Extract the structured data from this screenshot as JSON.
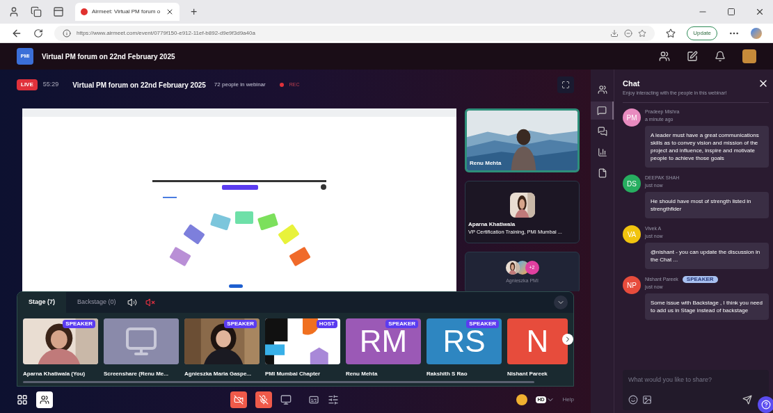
{
  "browser": {
    "tabs": [
      {
        "title": "Airmeet: Virtual PM forum o",
        "selected": true
      }
    ],
    "new_tab": "+",
    "url": "https://www.airmeet.com/event/0779f150-e912-11ef-b892-d9e9f3d9a40a",
    "update_button": "Update"
  },
  "header": {
    "logo": "PMI",
    "title": "Virtual PM forum on 22nd February 2025"
  },
  "session": {
    "live": "LIVE",
    "timer": "55:29",
    "title": "Virtual PM forum on 22nd February 2025",
    "attendees": "72 people in webinar",
    "recording": "REC"
  },
  "spotlight": [
    {
      "kind": "video",
      "name": "Renu Mehta",
      "selected": true
    },
    {
      "kind": "avatar",
      "name": "Aparna Khatiwala",
      "subtitle": "VP Certification Training, PMI Mumbai ...",
      "selected": false
    },
    {
      "kind": "group",
      "name": "Agnieszka PMI",
      "extra": "+2",
      "selected": false
    }
  ],
  "stage_tabs": [
    {
      "label": "Stage (7)",
      "selected": true
    },
    {
      "label": "Backstage (0)",
      "selected": false
    }
  ],
  "participants": [
    {
      "name": "Aparna Khatiwala  (You)",
      "badge": "SPEAKER"
    },
    {
      "kind": "screen",
      "name": "Screenshare (Renu Me..."
    },
    {
      "name": "Agnieszka Maria Gaspe...",
      "badge": "SPEAKER"
    },
    {
      "kind": "logo",
      "name": "PMI Mumbai Chapter",
      "badge": "HOST"
    },
    {
      "kind": "initials",
      "initials": "RM",
      "color": "#9b59b6",
      "name": "Renu Mehta",
      "badge": "SPEAKER"
    },
    {
      "kind": "initials",
      "initials": "RS",
      "color": "#2e86c1",
      "name": "Rakshith S Rao",
      "badge": "SPEAKER"
    },
    {
      "kind": "initials",
      "initials": "N",
      "color": "#e74c3c",
      "name": "Nishant Pareek"
    }
  ],
  "toolbar": {
    "help": "Help",
    "quality": "HD"
  },
  "sidebar": [
    {
      "kind": "people",
      "selected": false
    },
    {
      "kind": "chat",
      "selected": true
    },
    {
      "kind": "questions",
      "selected": false
    },
    {
      "kind": "polls",
      "selected": false
    },
    {
      "kind": "files",
      "selected": false
    }
  ],
  "chat": {
    "title": "Chat",
    "subtitle": "Enjoy interacting with the people in this webinar!",
    "messages": [
      {
        "initials": "PM",
        "color": "#e88bbf",
        "name": "Pradeep Mishra",
        "time": "a minute ago",
        "text": "A leader must have a great communications skills as to convey vision and mission of the project and influence, inspire and motivate people to achieve those goals"
      },
      {
        "initials": "DS",
        "color": "#27ae60",
        "name": "DEEPAK SHAH",
        "time": "just now",
        "text": "He should have most of strength listed in strengthfider"
      },
      {
        "initials": "VA",
        "color": "#f1c40f",
        "name": "Vivek A",
        "time": "just now",
        "text": "@nishant - you can update the discussion in the Chat ..."
      },
      {
        "initials": "NP",
        "color": "#e74c3c",
        "name": "Nishant Pareek",
        "badge": "SPEAKER",
        "time": "just now",
        "text": "Some issue with Backstage , I think you need to add us in Stage instead of backstage"
      }
    ],
    "input": {
      "placeholder": "What would you like to share?"
    }
  }
}
